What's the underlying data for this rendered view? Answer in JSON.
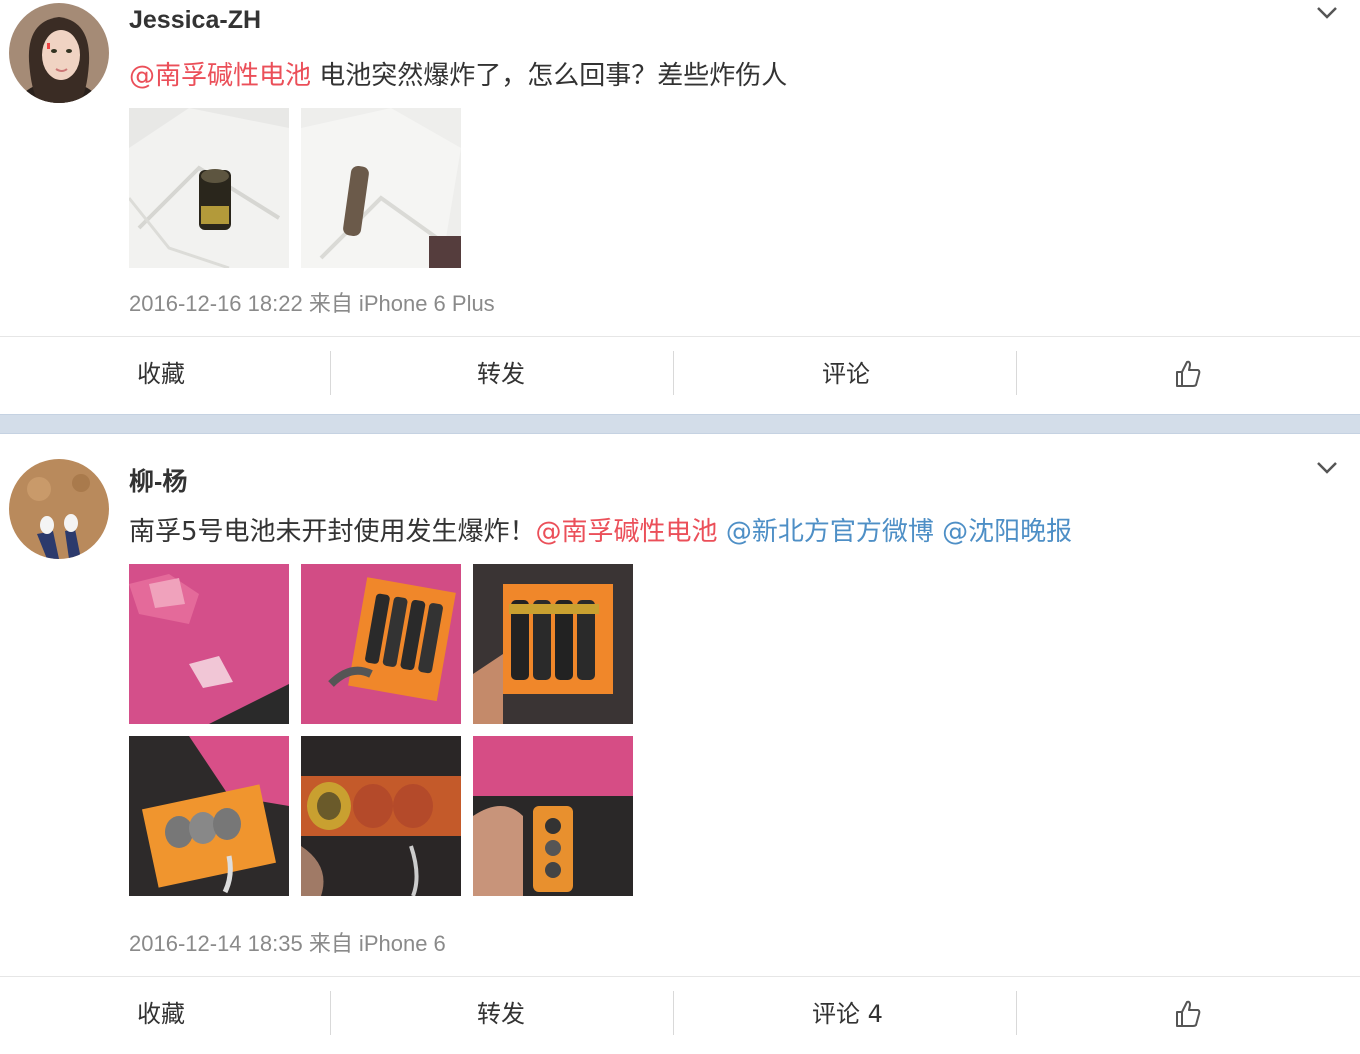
{
  "posts": [
    {
      "username": "Jessica-ZH",
      "text": {
        "mention": "@南孚碱性电池",
        "body": " 电池突然爆炸了，怎么回事？差些炸伤人"
      },
      "images": [
        "battery-photo-1",
        "battery-photo-2"
      ],
      "timestamp": "2016-12-16 18:22 来自 iPhone 6 Plus",
      "actions": {
        "favorite": "收藏",
        "repost": "转发",
        "comment": "评论",
        "like_icon": "thumbs-up-icon"
      }
    },
    {
      "username": "柳-杨",
      "text": {
        "body": "南孚5号电池未开封使用发生爆炸！",
        "mention_red": "@南孚碱性电池",
        "mention_blue_1": "@新北方官方微博",
        "mention_blue_2": "@沈阳晚报"
      },
      "images": [
        "pink-box-photo",
        "battery-pack-photo-1",
        "battery-pack-photo-2",
        "battery-pack-photo-3",
        "battery-closeup-photo",
        "battery-hand-photo"
      ],
      "timestamp": "2016-12-14 18:35 来自 iPhone 6",
      "actions": {
        "favorite": "收藏",
        "repost": "转发",
        "comment": "评论 4",
        "like_icon": "thumbs-up-icon"
      }
    }
  ],
  "colors": {
    "mention_red": "#eb4f59",
    "mention_blue": "#4e8fc6",
    "separator": "#d3dde9"
  }
}
